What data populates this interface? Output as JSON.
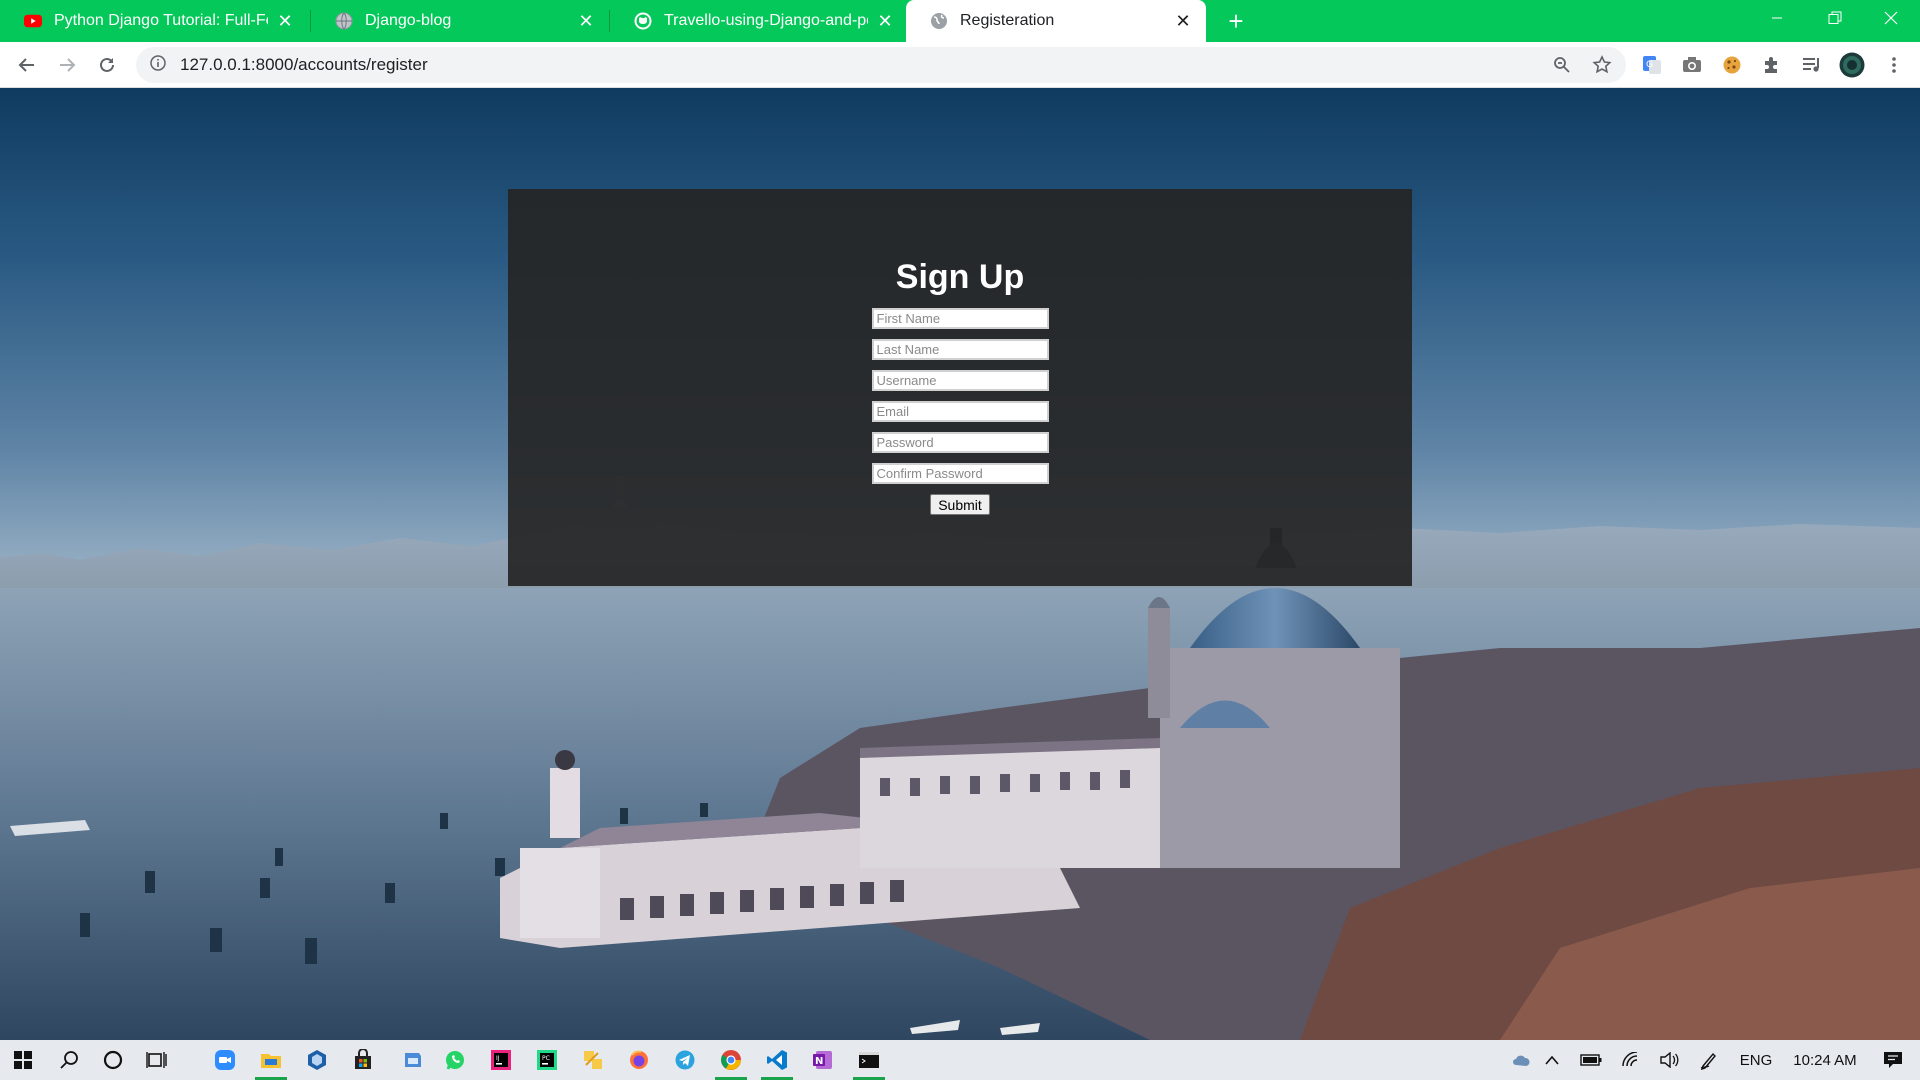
{
  "browser": {
    "tabs": [
      {
        "title": "Python Django Tutorial: Full-Featured",
        "favicon": "youtube-icon"
      },
      {
        "title": "Django-blog",
        "favicon": "globe-icon"
      },
      {
        "title": "Travello-using-Django-and-postgres",
        "favicon": "github-icon"
      },
      {
        "title": "Registeration",
        "favicon": "globe-icon"
      }
    ],
    "url": "127.0.0.1:8000/accounts/register",
    "theme_color": "#05c85a"
  },
  "form": {
    "heading": "Sign Up",
    "fields": {
      "first_name": "First Name",
      "last_name": "Last Name",
      "username": "Username",
      "email": "Email",
      "password": "Password",
      "confirm_password": "Confirm Password"
    },
    "submit_label": "Submit"
  },
  "taskbar": {
    "language": "ENG",
    "time": "10:24 AM"
  }
}
